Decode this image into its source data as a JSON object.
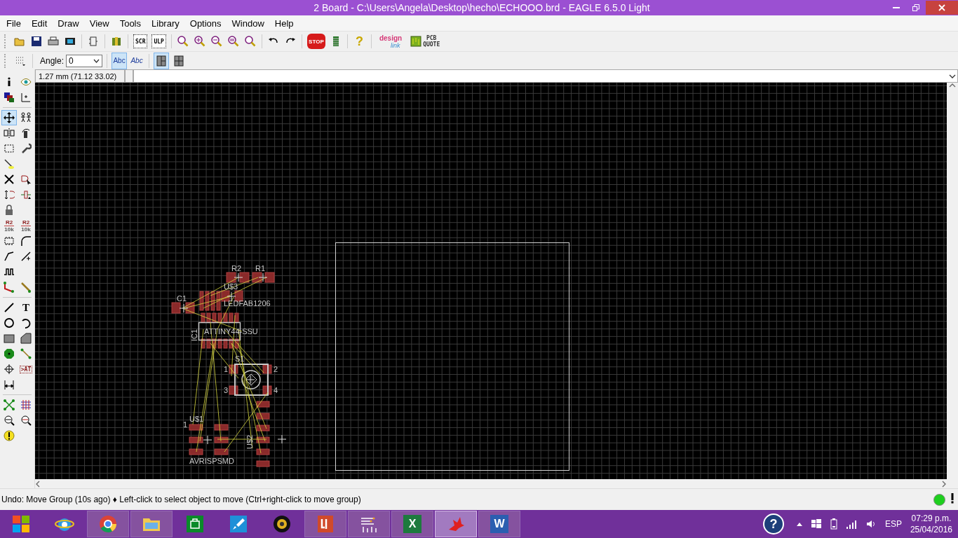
{
  "window": {
    "title": "2 Board - C:\\Users\\Angela\\Desktop\\hecho\\ECHOOO.brd - EAGLE 6.5.0 Light"
  },
  "menu": [
    "File",
    "Edit",
    "Draw",
    "View",
    "Tools",
    "Library",
    "Options",
    "Window",
    "Help"
  ],
  "toolbar": [
    {
      "kind": "open"
    },
    {
      "kind": "save"
    },
    {
      "kind": "print"
    },
    {
      "kind": "cam"
    },
    {
      "kind": "separator"
    },
    {
      "kind": "switch"
    },
    {
      "kind": "separator"
    },
    {
      "kind": "library"
    },
    {
      "kind": "separator"
    },
    {
      "kind": "script",
      "glyph": "SCR"
    },
    {
      "kind": "ulp",
      "glyph": "ULP"
    },
    {
      "kind": "separator"
    },
    {
      "kind": "zoom-fit"
    },
    {
      "kind": "zoom-in"
    },
    {
      "kind": "zoom-out"
    },
    {
      "kind": "zoom-select"
    },
    {
      "kind": "zoom-redraw"
    },
    {
      "kind": "separator"
    },
    {
      "kind": "undo"
    },
    {
      "kind": "redo"
    },
    {
      "kind": "separator"
    },
    {
      "kind": "stop",
      "glyph": "STOP"
    },
    {
      "kind": "go"
    },
    {
      "kind": "separator"
    },
    {
      "kind": "help",
      "glyph": "?"
    },
    {
      "kind": "separator"
    },
    {
      "kind": "designlink",
      "glyph": "design",
      "glyph2": "link"
    },
    {
      "kind": "pcbquote",
      "glyph": "PCB",
      "glyph2": "QUOTE"
    }
  ],
  "param_bar": {
    "angle_label": "Angle:",
    "angle_value": "0",
    "buttons": [
      {
        "kind": "text-upright",
        "glyph": "Abc",
        "selected": true
      },
      {
        "kind": "text-mirrored",
        "glyph": "Abc",
        "selected": false
      },
      {
        "kind": "layout-split",
        "selected": true
      },
      {
        "kind": "layout-quad",
        "selected": false
      }
    ]
  },
  "coordinates": "1.27 mm (71.12 33.02)",
  "tool_rows": [
    {
      "kind": "tools",
      "items": [
        {
          "kind": "info",
          "selected": false
        },
        {
          "kind": "eye",
          "selected": false
        }
      ]
    },
    {
      "kind": "tools",
      "items": [
        {
          "kind": "layers",
          "selected": false
        },
        {
          "kind": "axes",
          "selected": false
        }
      ]
    },
    {
      "kind": "separator"
    },
    {
      "kind": "tools",
      "items": [
        {
          "kind": "move",
          "selected": true
        },
        {
          "kind": "people",
          "selected": false
        }
      ]
    },
    {
      "kind": "tools",
      "items": [
        {
          "kind": "mirror",
          "selected": false
        },
        {
          "kind": "rotate",
          "selected": false
        }
      ]
    },
    {
      "kind": "tools",
      "items": [
        {
          "kind": "dashed-rect",
          "selected": false
        },
        {
          "kind": "wrench",
          "selected": false
        }
      ]
    },
    {
      "kind": "tools",
      "items": [
        {
          "kind": "pen",
          "selected": false
        }
      ]
    },
    {
      "kind": "tools",
      "items": [
        {
          "kind": "cross",
          "selected": false
        },
        {
          "kind": "chip-cursor",
          "selected": false
        }
      ]
    },
    {
      "kind": "tools",
      "items": [
        {
          "kind": "swap-arrows",
          "selected": false
        },
        {
          "kind": "gate-swap",
          "selected": false
        }
      ]
    },
    {
      "kind": "tools",
      "items": [
        {
          "kind": "lock",
          "selected": false
        }
      ]
    },
    {
      "kind": "tools",
      "items": [
        {
          "kind": "name-label",
          "glyph": "R2",
          "glyph2": "10k",
          "selected": false
        },
        {
          "kind": "value-label",
          "glyph": "R2",
          "glyph2": "10k",
          "selected": false
        }
      ]
    },
    {
      "kind": "tools",
      "items": [
        {
          "kind": "chip",
          "selected": false
        },
        {
          "kind": "curve",
          "selected": false
        }
      ]
    },
    {
      "kind": "tools",
      "items": [
        {
          "kind": "bent-line",
          "selected": false
        },
        {
          "kind": "split-line",
          "selected": false
        }
      ]
    },
    {
      "kind": "tools",
      "items": [
        {
          "kind": "square-wave",
          "selected": false
        }
      ]
    },
    {
      "kind": "tools",
      "items": [
        {
          "kind": "route",
          "selected": false
        },
        {
          "kind": "ripup",
          "selected": false
        }
      ]
    },
    {
      "kind": "separator"
    },
    {
      "kind": "tools",
      "items": [
        {
          "kind": "line",
          "selected": false
        },
        {
          "kind": "letter",
          "glyph": "T",
          "selected": false
        }
      ]
    },
    {
      "kind": "tools",
      "items": [
        {
          "kind": "circle",
          "selected": false
        },
        {
          "kind": "arc",
          "selected": false
        }
      ]
    },
    {
      "kind": "tools",
      "items": [
        {
          "kind": "hatched-rect",
          "selected": false
        },
        {
          "kind": "polygon",
          "selected": false
        }
      ]
    },
    {
      "kind": "tools",
      "items": [
        {
          "kind": "octagon",
          "selected": false
        },
        {
          "kind": "signal-line",
          "selected": false
        }
      ]
    },
    {
      "kind": "tools",
      "items": [
        {
          "kind": "crosshair",
          "selected": false
        },
        {
          "kind": "attribute",
          "glyph": ">AT",
          "selected": false
        }
      ]
    },
    {
      "kind": "tools",
      "items": [
        {
          "kind": "dimension",
          "selected": false
        }
      ]
    },
    {
      "kind": "separator"
    },
    {
      "kind": "tools",
      "items": [
        {
          "kind": "ratsnest",
          "selected": false
        },
        {
          "kind": "grid",
          "selected": false
        }
      ]
    },
    {
      "kind": "tools",
      "items": [
        {
          "kind": "zoom-erc",
          "selected": false
        },
        {
          "kind": "zoom-drc",
          "selected": false
        }
      ]
    },
    {
      "kind": "tools",
      "items": [
        {
          "kind": "warning",
          "selected": false
        }
      ]
    }
  ],
  "board": {
    "labels": [
      "R2",
      "R1",
      "U$3",
      "LEDFAB1206",
      "C1",
      "IC1",
      "ATTINY44-SSU",
      "S1",
      "1",
      "2",
      "3",
      "4",
      "U$1",
      "1",
      "AVRISPSMD",
      "U$2"
    ]
  },
  "status_bar": {
    "message": "Undo: Move Group (10s ago) ♦ Left-click to select object to move (Ctrl+right-click to move group)",
    "ready": true
  },
  "taskbar": {
    "apps": [
      {
        "kind": "start",
        "running": false,
        "selected": false
      },
      {
        "kind": "ie",
        "running": false,
        "selected": false
      },
      {
        "kind": "chrome",
        "running": true,
        "selected": false
      },
      {
        "kind": "folder",
        "running": true,
        "selected": false
      },
      {
        "kind": "store",
        "running": false,
        "selected": false
      },
      {
        "kind": "rocket",
        "running": false,
        "selected": false
      },
      {
        "kind": "webcam",
        "running": false,
        "selected": false
      },
      {
        "kind": "document-app",
        "running": true,
        "selected": false
      },
      {
        "kind": "sliders",
        "running": true,
        "selected": false
      },
      {
        "kind": "excel",
        "glyph": "X",
        "running": true,
        "selected": false
      },
      {
        "kind": "bird",
        "running": true,
        "selected": true
      },
      {
        "kind": "word",
        "glyph": "W",
        "running": true,
        "selected": false
      }
    ],
    "help_glyph": "?",
    "language": "ESP",
    "time": "07:29 p.m.",
    "date": "25/04/2016"
  }
}
